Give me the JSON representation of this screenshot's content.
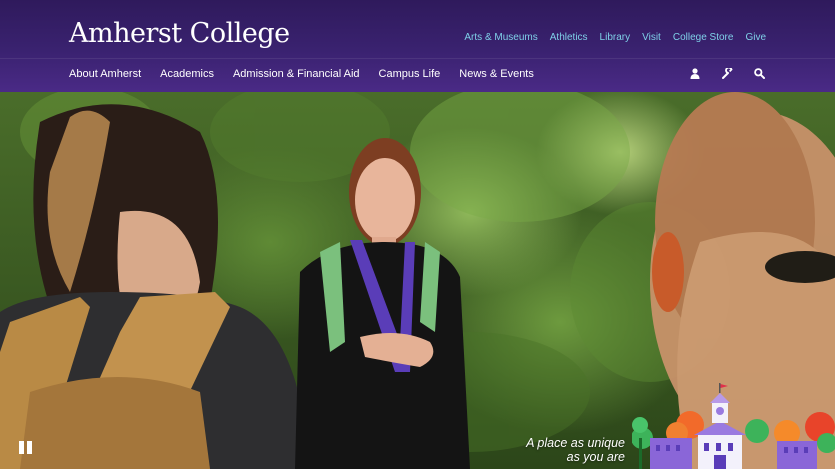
{
  "brand": {
    "name": "Amherst College"
  },
  "utility_nav": [
    {
      "label": "Arts & Museums"
    },
    {
      "label": "Athletics"
    },
    {
      "label": "Library"
    },
    {
      "label": "Visit"
    },
    {
      "label": "College Store"
    },
    {
      "label": "Give"
    }
  ],
  "main_nav": [
    {
      "label": "About Amherst"
    },
    {
      "label": "Academics"
    },
    {
      "label": "Admission & Financial Aid"
    },
    {
      "label": "Campus Life"
    },
    {
      "label": "News & Events"
    }
  ],
  "nav_icons": [
    "user-icon",
    "wrench-icon",
    "search-icon"
  ],
  "hero": {
    "tagline_line1": "A place as unique",
    "tagline_line2": "as you are",
    "video_control": "pause-icon"
  },
  "colors": {
    "header_purple": "#3a2270",
    "utility_link": "#7fd0e8",
    "brand_text": "#ffffff"
  }
}
